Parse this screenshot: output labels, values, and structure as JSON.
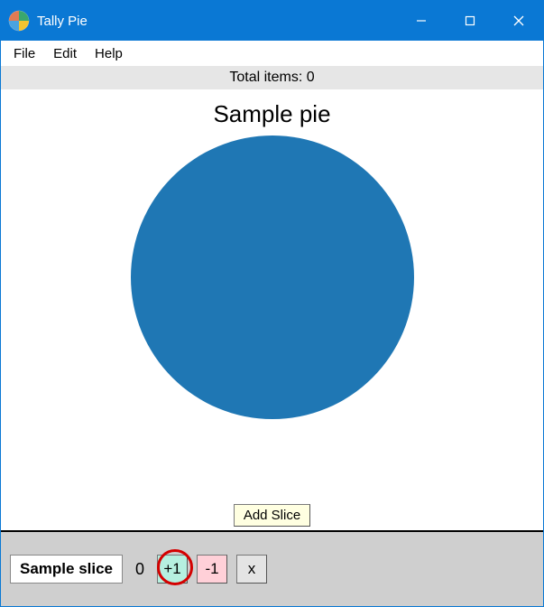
{
  "window": {
    "title": "Tally Pie"
  },
  "menu": {
    "file": "File",
    "edit": "Edit",
    "help": "Help"
  },
  "total_strip": {
    "label": "Total items: 0"
  },
  "chart_data": {
    "type": "pie",
    "title": "Sample pie",
    "categories": [
      "Sample slice"
    ],
    "values": [
      0
    ],
    "colors": [
      "#1f77b4"
    ]
  },
  "add_slice": {
    "label": "Add Slice"
  },
  "slice_row": {
    "name": "Sample slice",
    "count": "0",
    "plus_label": "+1",
    "minus_label": "-1",
    "delete_label": "x"
  }
}
